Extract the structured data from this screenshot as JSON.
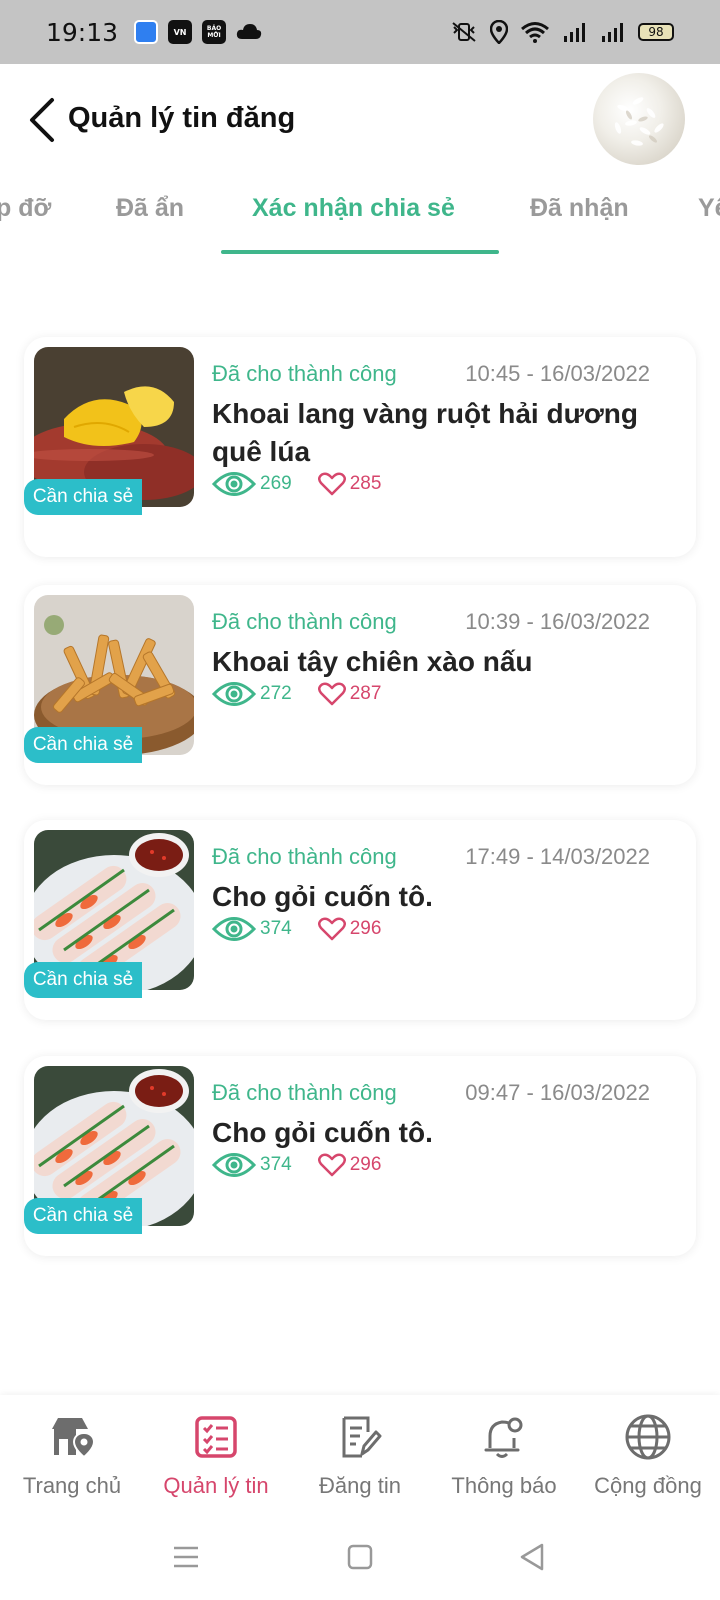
{
  "status_bar": {
    "time": "19:13",
    "battery": "98",
    "apps": [
      "VN",
      "BÁO MỚI"
    ]
  },
  "header": {
    "title": "Quản lý tin đăng"
  },
  "tabs": [
    {
      "label": "p đỡ"
    },
    {
      "label": "Đã ẩn"
    },
    {
      "label": "Xác nhận chia sẻ"
    },
    {
      "label": "Đã nhận"
    },
    {
      "label": "Yê"
    }
  ],
  "posts": [
    {
      "status": "Đã cho thành công",
      "time": "10:45 - 16/03/2022",
      "title": "Khoai lang vàng ruột hải dương quê lúa",
      "views": "269",
      "likes": "285",
      "badge": "Cần chia sẻ",
      "image": "sweet-potato"
    },
    {
      "status": "Đã cho thành công",
      "time": "10:39 - 16/03/2022",
      "title": "Khoai tây chiên xào nấu",
      "views": "272",
      "likes": "287",
      "badge": "Cần chia sẻ",
      "image": "fries"
    },
    {
      "status": "Đã cho thành công",
      "time": "17:49 - 14/03/2022",
      "title": "Cho gỏi cuốn tô.",
      "views": "374",
      "likes": "296",
      "badge": "Cần chia sẻ",
      "image": "spring-rolls"
    },
    {
      "status": "Đã cho thành công",
      "time": "09:47 - 16/03/2022",
      "title": "Cho gỏi cuốn tô.",
      "views": "374",
      "likes": "296",
      "badge": "Cần chia sẻ",
      "image": "spring-rolls"
    }
  ],
  "bottom_nav": [
    {
      "label": "Trang chủ",
      "icon": "home-location-icon"
    },
    {
      "label": "Quản lý tin",
      "icon": "checklist-icon"
    },
    {
      "label": "Đăng tin",
      "icon": "edit-document-icon"
    },
    {
      "label": "Thông báo",
      "icon": "bell-icon"
    },
    {
      "label": "Cộng đồng",
      "icon": "globe-icon"
    }
  ],
  "colors": {
    "accent": "#3fb68b",
    "active_nav": "#d6466c",
    "badge": "#2cbec9"
  }
}
